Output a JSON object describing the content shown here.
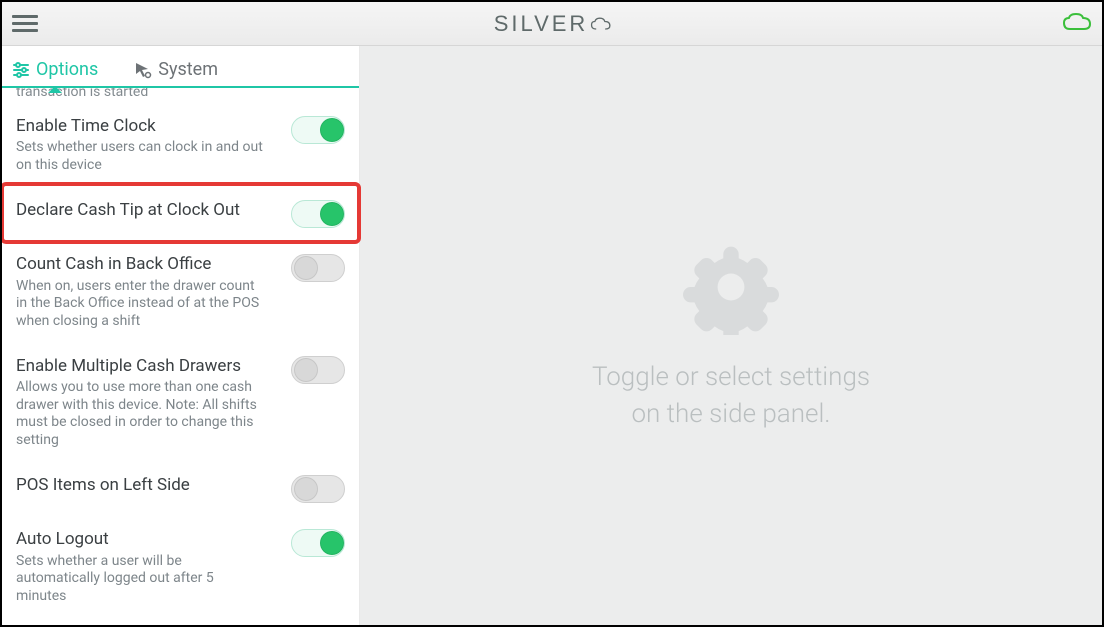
{
  "brand": "SILVER",
  "tabs": {
    "options": "Options",
    "system": "System"
  },
  "partial_prev": "transaction is started",
  "settings": [
    {
      "key": "time_clock",
      "title": "Enable Time Clock",
      "desc": "Sets whether users can clock in and out on this device",
      "on": true
    },
    {
      "key": "declare_cash_tip",
      "title": "Declare Cash Tip at Clock Out",
      "desc": "",
      "on": true,
      "highlighted": true
    },
    {
      "key": "count_cash_back_office",
      "title": "Count Cash in Back Office",
      "desc": "When on, users enter the drawer count in the Back Office instead of at the POS when closing a shift",
      "on": false
    },
    {
      "key": "multiple_cash_drawers",
      "title": "Enable Multiple Cash Drawers",
      "desc": "Allows you to use more than one cash drawer with this device. Note: All shifts must be closed in order to change this setting",
      "on": false
    },
    {
      "key": "pos_items_left",
      "title": "POS Items on Left Side",
      "desc": "",
      "on": false
    },
    {
      "key": "auto_logout",
      "title": "Auto Logout",
      "desc": "Sets whether a user will be automatically logged out after 5 minutes",
      "on": true
    }
  ],
  "main": {
    "line1": "Toggle or select settings",
    "line2": "on the side panel."
  },
  "colors": {
    "accent": "#1fc6a6",
    "toggle_on": "#27c46a",
    "highlight": "#e53935"
  }
}
